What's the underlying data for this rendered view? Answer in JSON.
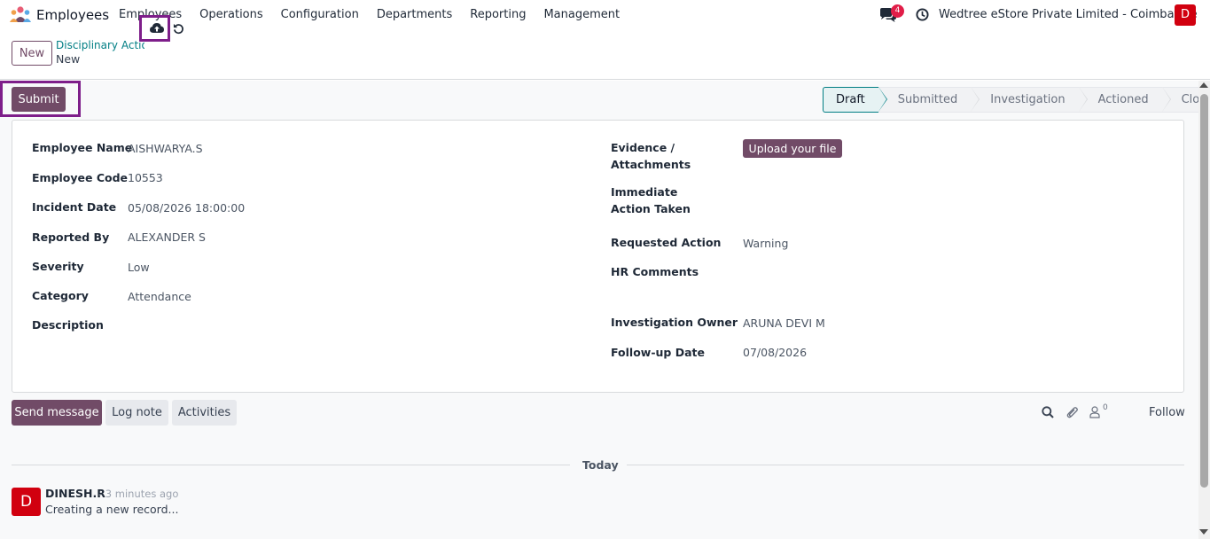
{
  "navbar": {
    "app_name": "Employees",
    "menu": [
      "Employees",
      "Operations",
      "Configuration",
      "Departments",
      "Reporting",
      "Management"
    ],
    "message_count": "4",
    "company": "Wedtree eStore Private Limited - Coimbatore",
    "user_initial": "D"
  },
  "control": {
    "new_label": "New",
    "breadcrumb_parent": "Disciplinary Action",
    "breadcrumb_current": "New"
  },
  "statusbar": {
    "submit_label": "Submit",
    "stages": [
      "Draft",
      "Submitted",
      "Investigation",
      "Actioned",
      "Closed"
    ],
    "active_stage": "Draft"
  },
  "form": {
    "left": [
      {
        "label": "Employee Name",
        "value": "AISHWARYA.S"
      },
      {
        "label": "Employee Code",
        "value": "10553"
      },
      {
        "label": "Incident Date",
        "value": "05/08/2026 18:00:00"
      },
      {
        "label": "Reported By",
        "value": "ALEXANDER S"
      },
      {
        "label": "Severity",
        "value": "Low"
      },
      {
        "label": "Category",
        "value": "Attendance"
      },
      {
        "label": "Description",
        "value": ""
      }
    ],
    "right": {
      "evidence_label": "Evidence / Attachments",
      "upload_label": "Upload your file",
      "immediate_label": "Immediate Action Taken",
      "requested_label": "Requested Action",
      "requested_value": "Warning",
      "hr_comments_label": "HR Comments",
      "owner_label": "Investigation Owner",
      "owner_value": "ARUNA DEVI M",
      "followup_label": "Follow-up Date",
      "followup_value": "07/08/2026"
    }
  },
  "chatter": {
    "send_label": "Send message",
    "log_label": "Log note",
    "activities_label": "Activities",
    "follower_count": "0",
    "follow_label": "Follow",
    "today_label": "Today",
    "message": {
      "avatar_initial": "D",
      "author": "DINESH.R",
      "time": "- 3 minutes ago",
      "body": "Creating a new record..."
    }
  },
  "colors": {
    "primary": "#714b67",
    "teal": "#017e84",
    "highlight": "#7e1e8a",
    "avatar": "#d1000f",
    "badge": "#e11d48"
  },
  "icons": [
    "users-logo-icon",
    "chat-icon",
    "clock-icon",
    "cloud-upload-icon",
    "undo-icon",
    "search-icon",
    "paperclip-icon",
    "user-icon"
  ]
}
